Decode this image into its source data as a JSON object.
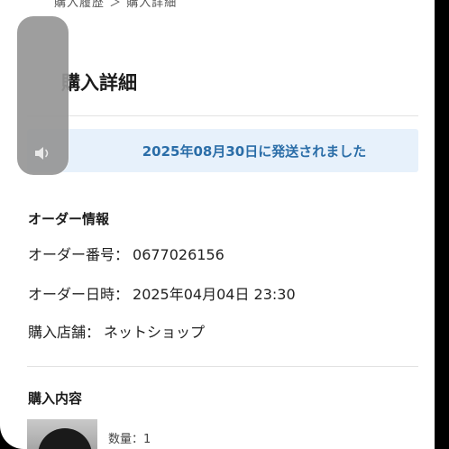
{
  "breadcrumb": "購入履歴 ＞ 購入詳細",
  "page": {
    "title": "購入詳細"
  },
  "shipping_banner": "2025年08月30日に発送されました",
  "order_info": {
    "section_title": "オーダー情報",
    "rows": [
      {
        "label": "オーダー番号：",
        "value": "0677026156"
      },
      {
        "label": "オーダー日時：",
        "value": "2025年04月04日 23:30"
      },
      {
        "label": "購入店舗：",
        "value": "ネットショップ"
      }
    ]
  },
  "purchase_contents": {
    "section_title": "購入内容",
    "items": [
      {
        "quantity_text": "数量：1"
      }
    ]
  },
  "icons": {
    "volume": "speaker-icon",
    "product": "cap-thumbnail"
  },
  "colors": {
    "banner_bg": "#e7f1fb",
    "banner_text": "#2b6ea8"
  }
}
